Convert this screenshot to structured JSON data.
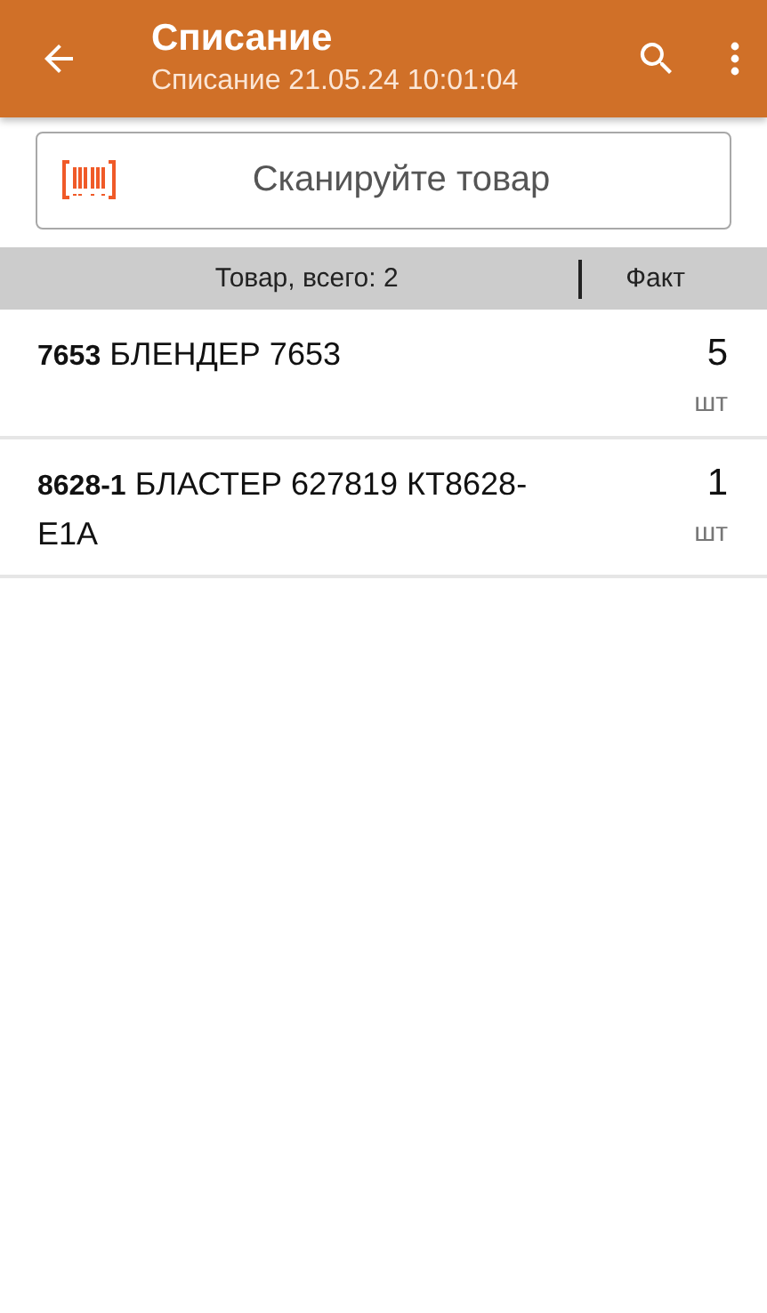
{
  "app_bar": {
    "title": "Списание",
    "subtitle": "Списание 21.05.24 10:01:04"
  },
  "scan_field": {
    "placeholder": "Сканируйте товар"
  },
  "table_header": {
    "total": "Товар, всего: 2",
    "fact": "Факт"
  },
  "items": [
    {
      "name": "**7653** БЛЕНДЕР 7653",
      "qty": "5",
      "unit": "шт"
    },
    {
      "name": "**8628-1** БЛАСТЕР 627819 КТ8628-E1A",
      "qty": "1",
      "unit": "шт"
    }
  ]
}
